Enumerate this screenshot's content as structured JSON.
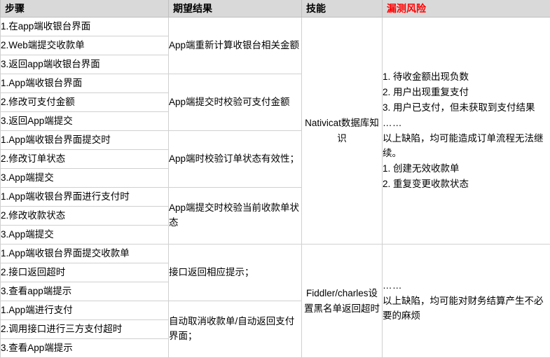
{
  "table": {
    "headers": [
      {
        "label": "步骤",
        "color": "#000000"
      },
      {
        "label": "期望结果",
        "color": "#000000"
      },
      {
        "label": "技能",
        "color": "#000000"
      },
      {
        "label": "漏测风险",
        "color": "#ff0000"
      }
    ],
    "steps": [
      "1.在app端收银台界面",
      "2.Web端提交收款单",
      "3.返回app端收银台界面",
      "1.App端收银台界面",
      "2.修改可支付金额",
      "3.返回App端提交",
      "1.App端收银台界面提交时",
      "2.修改订单状态",
      "3.App端提交",
      "1.App端收银台界面进行支付时",
      "2.修改收款状态",
      "3.App端提交",
      "1.App端收银台界面提交收款单",
      "2.接口返回超时",
      "3.查看app端提示",
      "1.App端进行支付",
      "2.调用接口进行三方支付超时",
      "3.查看App端提示"
    ],
    "expected_results": [
      "App端重新计算收银台相关金额",
      "App端提交时校验可支付金额",
      "App端时校验订单状态有效性；",
      "App端提交时校验当前收款单状态",
      "接口返回相应提示；",
      "自动取消收款单/自动返回支付界面；"
    ],
    "skills": [
      "Nativicat数据库知识",
      "Fiddler/charles设置黑名单返回超时"
    ],
    "risks": [
      [
        "1. 待收金额出现负数",
        "2. 用户出现重复支付",
        "3. 用户已支付，但未获取到支付结果",
        "……",
        "以上缺陷，均可能造成订单流程无法继续。",
        "1. 创建无效收款单",
        "2. 重复变更收款状态"
      ],
      [
        "……",
        "以上缺陷，均可能对财务结算产生不必要的麻烦"
      ]
    ]
  }
}
